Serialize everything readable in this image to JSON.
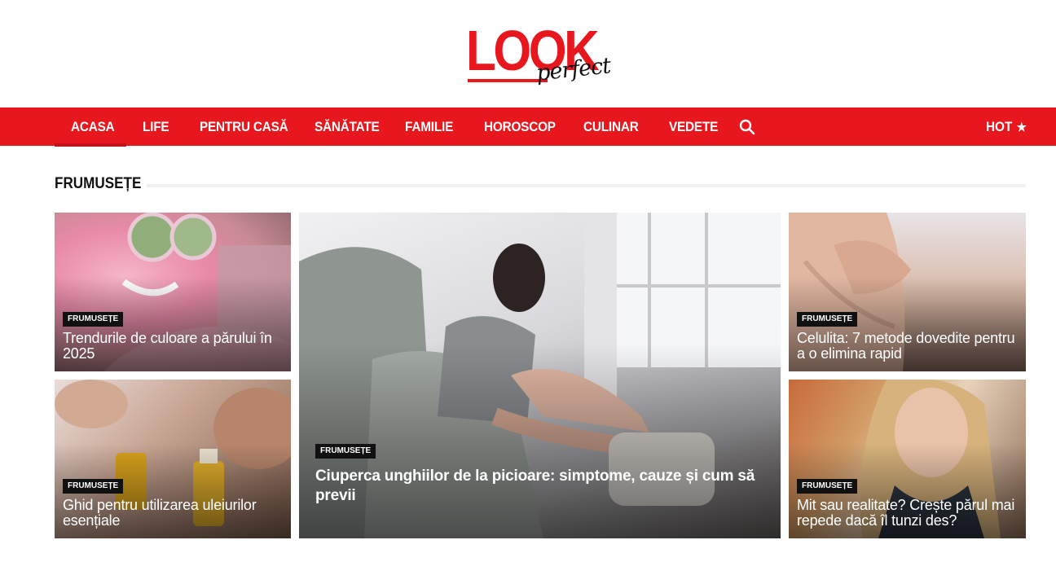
{
  "site": {
    "logo_main": "LOOK",
    "logo_sub": "perfect",
    "accent_color": "#e8171e"
  },
  "nav": {
    "items": [
      {
        "label": "ACASA"
      },
      {
        "label": "LIFE"
      },
      {
        "label": "PENTRU CASĂ"
      },
      {
        "label": "SĂNĂTATE"
      },
      {
        "label": "FAMILIE"
      },
      {
        "label": "HOROSCOP"
      },
      {
        "label": "CULINAR"
      },
      {
        "label": "VEDETE"
      }
    ],
    "active": "ACASA",
    "search_icon": "search-icon",
    "hot_label": "HOT",
    "hot_icon": "★"
  },
  "section": {
    "title": "FRUMUSEȚE"
  },
  "cards": [
    {
      "category": "FRUMUSEȚE",
      "title": "Trendurile de culoare a părului în 2025"
    },
    {
      "category": "FRUMUSEȚE",
      "title": "Ghid pentru utilizarea uleiurilor esențiale"
    },
    {
      "category": "FRUMUSEȚE",
      "title": "Ciuperca unghiilor de la picioare: simptome, cauze și cum să previi"
    },
    {
      "category": "FRUMUSEȚE",
      "title": "Celulita: 7 metode dovedite pentru a o elimina rapid"
    },
    {
      "category": "FRUMUSEȚE",
      "title": "Mit sau realitate? Crește părul mai repede dacă îl tunzi des?"
    }
  ]
}
